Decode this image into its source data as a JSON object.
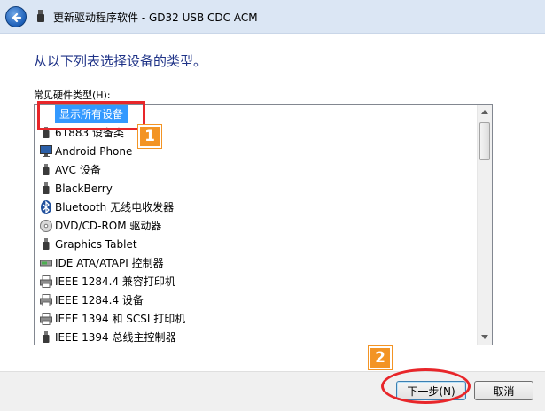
{
  "window": {
    "title": "更新驱动程序软件 - GD32 USB CDC ACM"
  },
  "main": {
    "heading": "从以下列表选择设备的类型。",
    "list_label": "常见硬件类型(H):",
    "items": [
      {
        "label": "显示所有设备",
        "icon": "none",
        "selected": true
      },
      {
        "label": "61883 设备类",
        "icon": "usb-plug-icon",
        "selected": false
      },
      {
        "label": "Android Phone",
        "icon": "computer-icon",
        "selected": false
      },
      {
        "label": "AVC 设备",
        "icon": "usb-plug-icon",
        "selected": false
      },
      {
        "label": "BlackBerry",
        "icon": "usb-plug-icon",
        "selected": false
      },
      {
        "label": "Bluetooth 无线电收发器",
        "icon": "bluetooth-icon",
        "selected": false
      },
      {
        "label": "DVD/CD-ROM 驱动器",
        "icon": "disc-drive-icon",
        "selected": false
      },
      {
        "label": "Graphics Tablet",
        "icon": "usb-plug-icon",
        "selected": false
      },
      {
        "label": "IDE ATA/ATAPI 控制器",
        "icon": "controller-icon",
        "selected": false
      },
      {
        "label": "IEEE 1284.4 兼容打印机",
        "icon": "printer-icon",
        "selected": false
      },
      {
        "label": "IEEE 1284.4 设备",
        "icon": "printer-icon",
        "selected": false
      },
      {
        "label": "IEEE 1394 和 SCSI 打印机",
        "icon": "printer-icon",
        "selected": false
      },
      {
        "label": "IEEE 1394 总线主控制器",
        "icon": "usb-plug-icon",
        "selected": false
      }
    ]
  },
  "footer": {
    "next_label": "下一步(N)",
    "cancel_label": "取消"
  },
  "annotations": {
    "badge_1": "1",
    "badge_2": "2",
    "color": "#e8262a",
    "badge_color": "#f39424"
  },
  "colors": {
    "selection": "#3399ff",
    "heading": "#1e3287"
  }
}
